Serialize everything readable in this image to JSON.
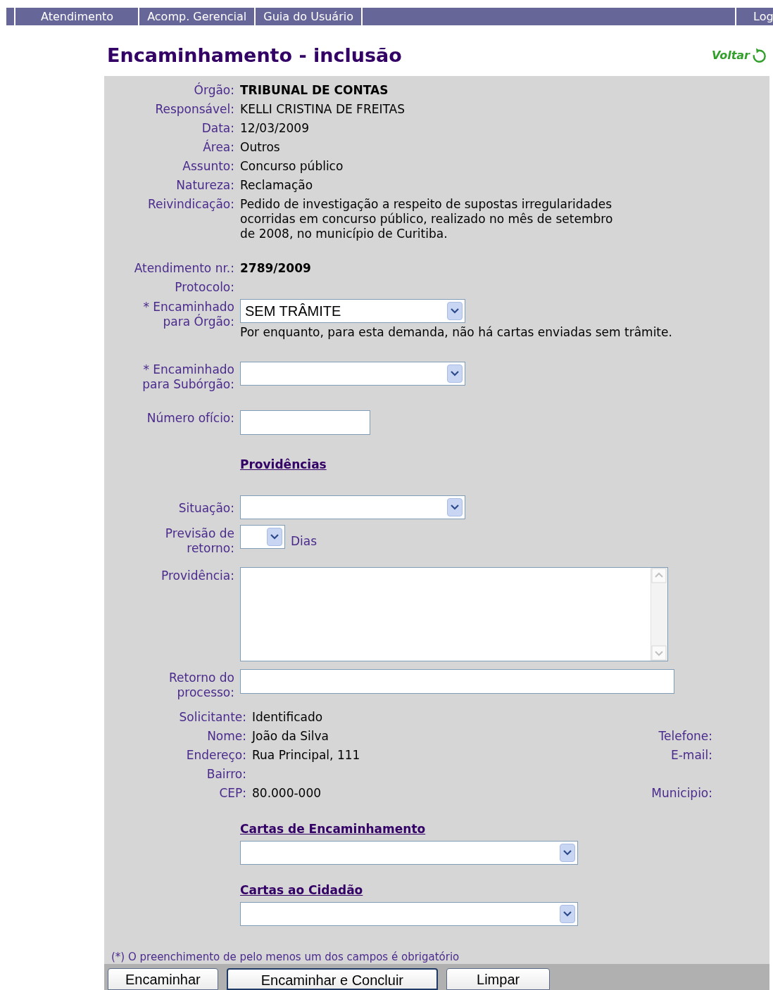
{
  "nav": {
    "items": [
      {
        "label": "Atendimento"
      },
      {
        "label": "Acomp. Gerencial"
      },
      {
        "label": "Guia do Usuário"
      }
    ],
    "right_item": "Log"
  },
  "title": "Encaminhamento - inclusão",
  "back_link": "Voltar",
  "details": [
    {
      "label": "Órgão:",
      "value": "TRIBUNAL DE CONTAS",
      "bold": true
    },
    {
      "label": "Responsável:",
      "value": "KELLI CRISTINA DE FREITAS",
      "bold": false
    },
    {
      "label": "Data:",
      "value": "12/03/2009",
      "bold": false
    },
    {
      "label": "Área:",
      "value": "Outros",
      "bold": false
    },
    {
      "label": "Assunto:",
      "value": "Concurso público",
      "bold": false
    },
    {
      "label": "Natureza:",
      "value": "Reclamação",
      "bold": false
    },
    {
      "label": "Reivindicação:",
      "value": "Pedido de investigação a respeito de supostas irregularidades ocorridas em concurso público, realizado no mês de setembro de 2008, no município de Curitiba.",
      "bold": false
    }
  ],
  "atendimento": [
    {
      "label": "Atendimento nr.:",
      "value": "2789/2009",
      "bold": true
    },
    {
      "label": "Protocolo:",
      "bold": false
    }
  ],
  "fields": [
    {
      "kind": "select",
      "label_lines": [
        "* Encaminhado",
        "para Órgão:"
      ],
      "value": "SEM TRÂMITE",
      "note": "Por enquanto, para esta demanda, não há cartas enviadas sem trâmite."
    },
    {
      "kind": "select",
      "label_lines": [
        "* Encaminhado",
        "para Subórgão:"
      ]
    },
    {
      "kind": "input",
      "label_lines": [
        "Número ofício:"
      ]
    }
  ],
  "providencias": {
    "heading": "Providências",
    "fields": [
      {
        "kind": "select",
        "label_lines": [
          "Situação:"
        ]
      },
      {
        "kind": "small_select",
        "label_lines": [
          "Previsão de",
          "retorno:"
        ],
        "suffix": "Dias"
      },
      {
        "kind": "textarea",
        "label_lines": [
          "Providência:"
        ]
      },
      {
        "kind": "wide_input",
        "label_lines": [
          "Retorno do",
          "processo:"
        ]
      }
    ]
  },
  "solicitante": {
    "label": "Solicitante:",
    "value": "Identificado",
    "rows": [
      {
        "left": {
          "label": "Nome:",
          "value": "João da Silva"
        },
        "right": {
          "label": "Telefone:"
        }
      },
      {
        "left": {
          "label": "Endereço:",
          "value": "Rua Principal, 111"
        },
        "right": {
          "label": "E-mail:"
        }
      },
      {
        "left": {
          "label": "Bairro:"
        }
      },
      {
        "left": {
          "label": "CEP:",
          "value": "80.000-000"
        },
        "right": {
          "label": "Municipio:"
        }
      }
    ]
  },
  "letters": [
    {
      "heading": "Cartas de Encaminhamento"
    },
    {
      "heading": "Cartas ao Cidadão"
    }
  ],
  "note": "(*) O preenchimento de pelo menos um dos campos é obrigatório",
  "buttons": [
    {
      "label": "Encaminhar",
      "focused": false
    },
    {
      "label": "Encaminhar e Concluir",
      "focused": true
    },
    {
      "label": "Limpar",
      "focused": false
    }
  ]
}
